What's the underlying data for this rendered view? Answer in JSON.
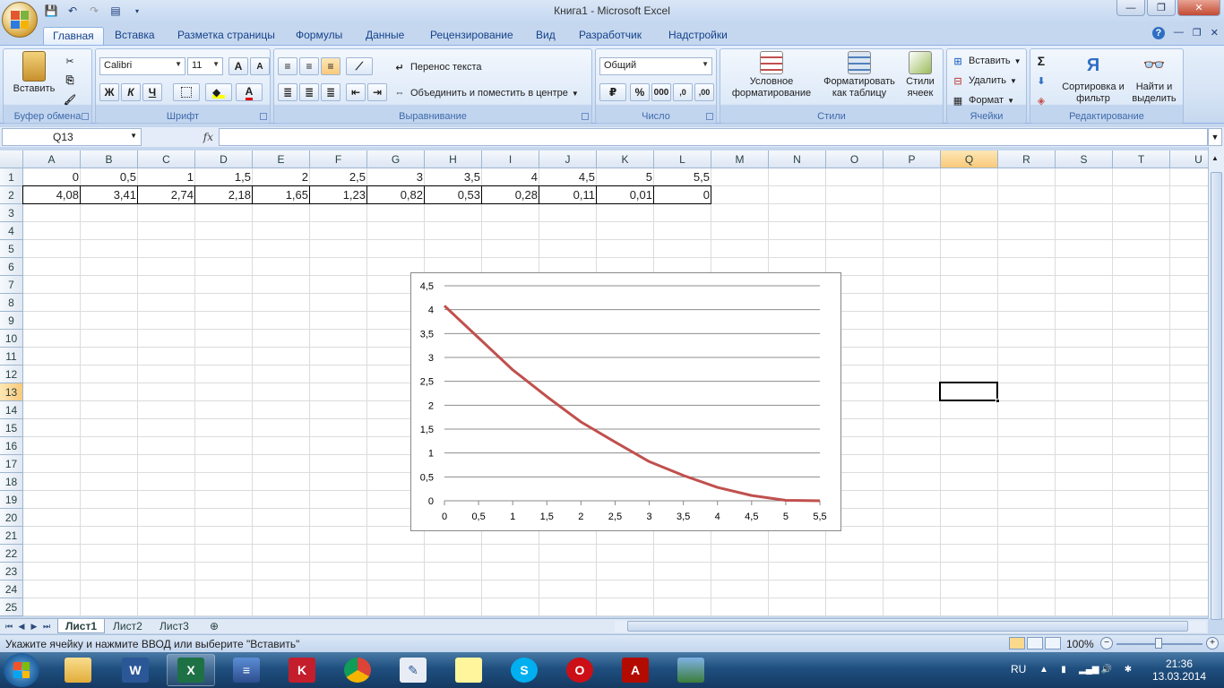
{
  "window": {
    "title": "Книга1 - Microsoft Excel",
    "minimize": "—",
    "restore": "❐",
    "close": "✕"
  },
  "ribbon_tabs": [
    "Главная",
    "Вставка",
    "Разметка страницы",
    "Формулы",
    "Данные",
    "Рецензирование",
    "Вид",
    "Разработчик",
    "Надстройки"
  ],
  "ribbon": {
    "clipboard": {
      "label": "Буфер обмена",
      "paste": "Вставить"
    },
    "font": {
      "label": "Шрифт",
      "name": "Calibri",
      "size": "11",
      "bold": "Ж",
      "italic": "К",
      "underline": "Ч",
      "grow": "A",
      "shrink": "A",
      "font_color": "A"
    },
    "alignment": {
      "label": "Выравнивание",
      "wrap": "Перенос текста",
      "merge": "Объединить и поместить в центре"
    },
    "number": {
      "label": "Число",
      "format": "Общий",
      "percent": "%",
      "thousands": "000",
      "inc_dec": ",0",
      "dec_dec": ",00"
    },
    "styles": {
      "label": "Стили",
      "conditional": "Условное форматирование",
      "format_table": "Форматировать как таблицу",
      "cell_styles": "Стили ячеек"
    },
    "cells": {
      "label": "Ячейки",
      "insert": "Вставить",
      "delete": "Удалить",
      "format": "Формат"
    },
    "editing": {
      "label": "Редактирование",
      "sort": "Сортировка и фильтр",
      "find": "Найти и выделить",
      "sum": "Σ"
    }
  },
  "formula_bar": {
    "name_box": "Q13",
    "fx": "fx",
    "formula": ""
  },
  "columns": [
    "A",
    "B",
    "C",
    "D",
    "E",
    "F",
    "G",
    "H",
    "I",
    "J",
    "K",
    "L",
    "M",
    "N",
    "O",
    "P",
    "Q",
    "R",
    "S",
    "T",
    "U"
  ],
  "rows": [
    "1",
    "2",
    "3",
    "4",
    "5",
    "6",
    "7",
    "8",
    "9",
    "10",
    "11",
    "12",
    "13",
    "14",
    "15",
    "16",
    "17",
    "18",
    "19",
    "20",
    "21",
    "22",
    "23",
    "24",
    "25"
  ],
  "selected": {
    "col": "Q",
    "row": "13"
  },
  "cells": {
    "row1": [
      "0",
      "0,5",
      "1",
      "1,5",
      "2",
      "2,5",
      "3",
      "3,5",
      "4",
      "4,5",
      "5",
      "5,5"
    ],
    "row2": [
      "4,08",
      "3,41",
      "2,74",
      "2,18",
      "1,65",
      "1,23",
      "0,82",
      "0,53",
      "0,28",
      "0,11",
      "0,01",
      "0"
    ]
  },
  "chart_data": {
    "type": "line",
    "categories": [
      "0",
      "0,5",
      "1",
      "1,5",
      "2",
      "2,5",
      "3",
      "3,5",
      "4",
      "4,5",
      "5",
      "5,5"
    ],
    "series": [
      {
        "values": [
          4.08,
          3.41,
          2.74,
          2.18,
          1.65,
          1.23,
          0.82,
          0.53,
          0.28,
          0.11,
          0.01,
          0
        ],
        "color": "#c0504d"
      }
    ],
    "ylim": [
      0,
      4.5
    ],
    "y_ticks": [
      "0",
      "0,5",
      "1",
      "1,5",
      "2",
      "2,5",
      "3",
      "3,5",
      "4",
      "4,5"
    ],
    "grid": true,
    "legend": "none"
  },
  "sheet_tabs": [
    "Лист1",
    "Лист2",
    "Лист3"
  ],
  "status": {
    "text": "Укажите ячейку и нажмите ВВОД или выберите \"Вставить\"",
    "zoom": "100%"
  },
  "taskbar": {
    "apps": [
      "explorer",
      "word",
      "excel",
      "rar",
      "kaspersky",
      "chrome",
      "notes",
      "sticky",
      "skype",
      "opera",
      "pdf",
      "photo"
    ],
    "lang": "RU",
    "time": "21:36",
    "date": "13.03.2014"
  },
  "colors": {
    "accent": "#15428b",
    "series": "#c0504d",
    "selected_header": "#f9c97a"
  }
}
